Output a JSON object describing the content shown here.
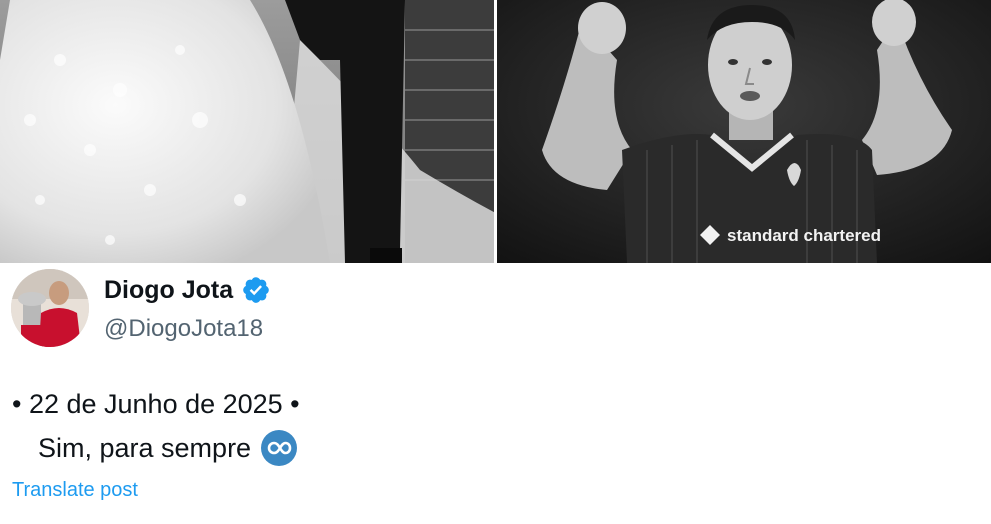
{
  "post": {
    "author": {
      "name": "Diogo Jota",
      "handle": "@DiogoJota18",
      "verified": true,
      "verified_icon": "verified-badge-icon"
    },
    "text_line_1": "• 22 de Junho de 2025 •",
    "text_line_2": "Sim, para sempre",
    "emoji": "infinity-icon",
    "translate_label": "Translate post"
  },
  "media": {
    "images": [
      {
        "description_name": "wedding-photo"
      },
      {
        "description_name": "celebration-photo"
      }
    ],
    "jersey_sponsor": "standard chartered"
  },
  "colors": {
    "link": "#1d9bf0",
    "verified": "#1d9bf0",
    "name": "#0f1419",
    "handle": "#536471"
  }
}
